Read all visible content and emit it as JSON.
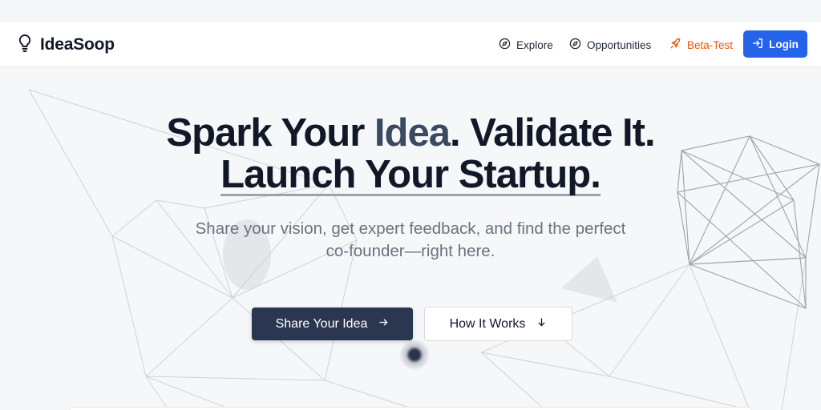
{
  "navbar": {
    "brand": "IdeaSoop",
    "links": [
      {
        "label": "Explore",
        "icon": "compass-icon"
      },
      {
        "label": "Opportunities",
        "icon": "compass-icon"
      },
      {
        "label": "Beta-Test",
        "icon": "rocket-icon"
      }
    ],
    "login_label": "Login"
  },
  "hero": {
    "title_part1": "Spark Your ",
    "title_accent": "Idea",
    "title_part2": ". Validate It.",
    "title_line2": "Launch Your Startup.",
    "subtitle": "Share your vision, get expert feedback, and find the perfect co-founder—right here.",
    "primary_cta": "Share Your Idea",
    "secondary_cta": "How It Works"
  },
  "colors": {
    "primary_button": "#2b3650",
    "login_button": "#2563eb",
    "beta_accent": "#ea580c",
    "title_accent": "#3b4a63"
  }
}
